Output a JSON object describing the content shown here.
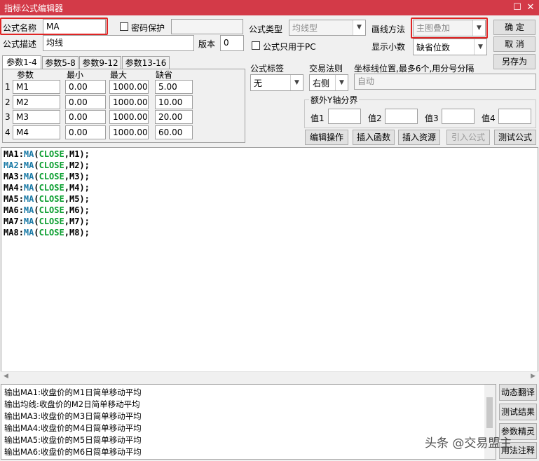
{
  "window": {
    "title": "指标公式编辑器",
    "restore_glyph": "☐",
    "close_glyph": "✕"
  },
  "formula": {
    "name_label": "公式名称",
    "name_value": "MA",
    "password_label": "密码保护",
    "type_label": "公式类型",
    "type_value": "均线型",
    "draw_method_label": "画线方法",
    "draw_method_value": "主图叠加",
    "desc_label": "公式描述",
    "desc_value": "均线",
    "version_label": "版本",
    "version_value": "0",
    "pc_only_label": "公式只用于PC",
    "decimal_label": "显示小数",
    "decimal_value": "缺省位数"
  },
  "buttons": {
    "ok": "确  定",
    "cancel": "取  消",
    "save_as": "另存为",
    "edit_ops": "编辑操作",
    "insert_func": "插入函数",
    "insert_res": "插入资源",
    "import_formula": "引入公式",
    "test_formula": "测试公式"
  },
  "param_tabs": [
    "参数1-4",
    "参数5-8",
    "参数9-12",
    "参数13-16"
  ],
  "param_table": {
    "headers": [
      "参数",
      "最小",
      "最大",
      "缺省"
    ],
    "rows": [
      {
        "idx": "1",
        "name": "M1",
        "min": "0.00",
        "max": "1000.00",
        "def": "5.00"
      },
      {
        "idx": "2",
        "name": "M2",
        "min": "0.00",
        "max": "1000.00",
        "def": "10.00"
      },
      {
        "idx": "3",
        "name": "M3",
        "min": "0.00",
        "max": "1000.00",
        "def": "20.00"
      },
      {
        "idx": "4",
        "name": "M4",
        "min": "0.00",
        "max": "1000.00",
        "def": "60.00"
      }
    ]
  },
  "right_panel": {
    "tag_label": "公式标签",
    "tag_value": "无",
    "trade_rule_label": "交易法则",
    "trade_rule_value": "右侧",
    "coord_label": "坐标线位置,最多6个,用分号分隔",
    "coord_value": "自动",
    "extra_y_label": "额外Y轴分界",
    "val1": "值1",
    "val2": "值2",
    "val3": "值3",
    "val4": "值4"
  },
  "code_lines": [
    {
      "name": "MA1",
      "func": "MA",
      "arg": "CLOSE",
      "param": "M1"
    },
    {
      "name": "MA2",
      "func": "MA",
      "arg": "CLOSE",
      "param": "M2"
    },
    {
      "name": "MA3",
      "func": "MA",
      "arg": "CLOSE",
      "param": "M3"
    },
    {
      "name": "MA4",
      "func": "MA",
      "arg": "CLOSE",
      "param": "M4"
    },
    {
      "name": "MA5",
      "func": "MA",
      "arg": "CLOSE",
      "param": "M5"
    },
    {
      "name": "MA6",
      "func": "MA",
      "arg": "CLOSE",
      "param": "M6"
    },
    {
      "name": "MA7",
      "func": "MA",
      "arg": "CLOSE",
      "param": "M7"
    },
    {
      "name": "MA8",
      "func": "MA",
      "arg": "CLOSE",
      "param": "M8"
    }
  ],
  "output_lines": [
    "输出MA1:收盘价的M1日简单移动平均",
    "输出均线:收盘价的M2日简单移动平均",
    "输出MA3:收盘价的M3日简单移动平均",
    "输出MA4:收盘价的M4日简单移动平均",
    "输出MA5:收盘价的M5日简单移动平均",
    "输出MA6:收盘价的M6日简单移动平均"
  ],
  "side_buttons": [
    "动态翻译",
    "测试结果",
    "参数精灵",
    "用法注释"
  ],
  "watermark": "头条 @交易盟主",
  "colors": {
    "titlebar": "#d33a48",
    "highlight_border": "#e02525",
    "code_func": "#1a7aa6",
    "code_keyword": "#0a9e2f"
  }
}
